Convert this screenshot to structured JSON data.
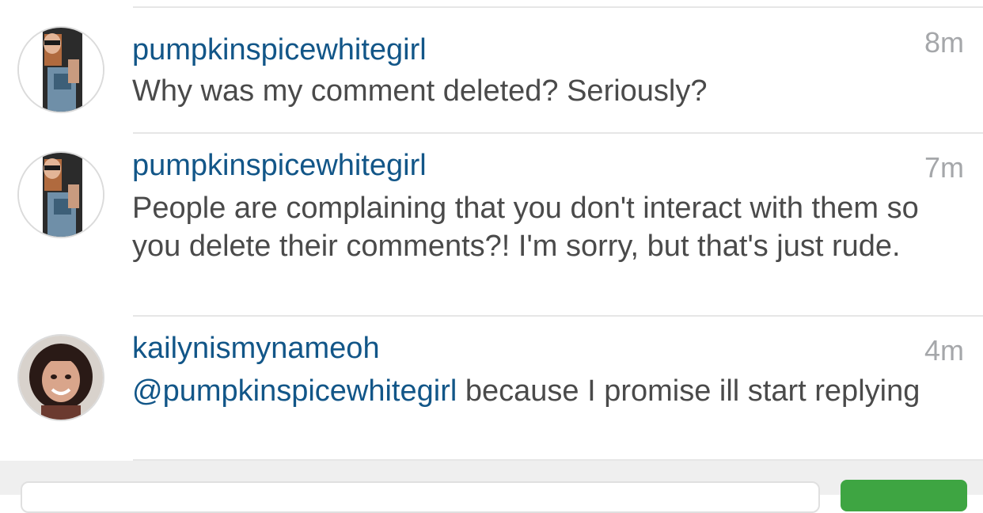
{
  "comments": [
    {
      "username": "pumpkinspicewhitegirl",
      "time": "8m",
      "text": "Why was my comment deleted? Seriously?"
    },
    {
      "username": "pumpkinspicewhitegirl",
      "time": "7m",
      "text": "People are complaining that you don't interact with them so you delete their comments?! I'm sorry, but that's just rude."
    },
    {
      "username": "kailynismynameoh",
      "time": "4m",
      "mention": "@pumpkinspicewhitegirl",
      "text": " because I promise ill start replying"
    }
  ],
  "colors": {
    "username": "#125688",
    "text": "#4a4a4a",
    "time": "#a5a7aa",
    "post_button": "#3ea542"
  },
  "icons": {
    "avatar_1": "user-avatar-photo",
    "avatar_2": "user-avatar-photo",
    "avatar_3": "user-avatar-photo"
  }
}
